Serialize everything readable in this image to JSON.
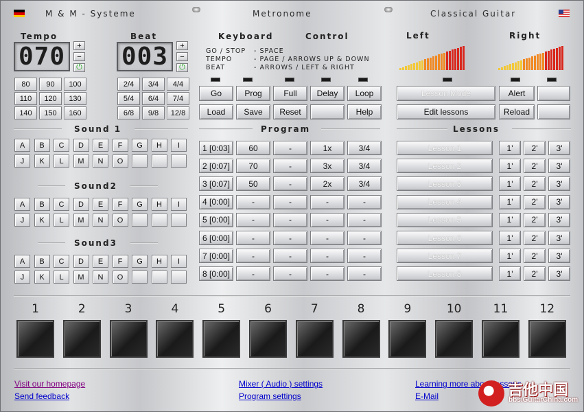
{
  "header": {
    "app_title": "M & M - Systeme",
    "center_title": "Metronome",
    "right_title": "Classical Guitar"
  },
  "tempo": {
    "label": "Tempo",
    "display": "070",
    "plus": "+",
    "minus": "−",
    "buttons": [
      "80",
      "90",
      "100",
      "110",
      "120",
      "130",
      "140",
      "150",
      "160"
    ]
  },
  "beat": {
    "label": "Beat",
    "display": "003",
    "plus": "+",
    "minus": "−",
    "buttons": [
      "2/4",
      "3/4",
      "4/4",
      "5/4",
      "6/4",
      "7/4",
      "6/8",
      "9/8",
      "12/8"
    ]
  },
  "keyboard": {
    "label": "Keyboard",
    "control_label": "Control",
    "lines": [
      {
        "k": "GO / STOP",
        "v": "- SPACE"
      },
      {
        "k": "TEMPO",
        "v": "- PAGE / ARROWS UP & DOWN"
      },
      {
        "k": "BEAT",
        "v": "- ARROWS / LEFT & RIGHT"
      }
    ]
  },
  "meters": {
    "left": "Left",
    "right": "Right"
  },
  "controls": [
    "Go",
    "Prog",
    "Full",
    "Delay",
    "Loop",
    "Load",
    "Save",
    "Reset",
    "",
    "Help"
  ],
  "lesson_controls": {
    "lesson_mode": "Lesson Mode",
    "alert": "Alert",
    "edit": "Edit lessons",
    "reload": "Reload"
  },
  "sound1": {
    "label": "Sound 1",
    "row1": [
      "A",
      "B",
      "C",
      "D",
      "E",
      "F",
      "G",
      "H",
      "I"
    ],
    "row2": [
      "J",
      "K",
      "L",
      "M",
      "N",
      "O",
      "",
      ""
    ]
  },
  "sound2": {
    "label": "Sound2",
    "row1": [
      "A",
      "B",
      "C",
      "D",
      "E",
      "F",
      "G",
      "H",
      "I"
    ],
    "row2": [
      "J",
      "K",
      "L",
      "M",
      "N",
      "O",
      "",
      ""
    ]
  },
  "sound3": {
    "label": "Sound3",
    "row1": [
      "A",
      "B",
      "C",
      "D",
      "E",
      "F",
      "G",
      "H",
      "I"
    ],
    "row2": [
      "J",
      "K",
      "L",
      "M",
      "N",
      "O",
      "",
      ""
    ]
  },
  "program": {
    "label": "Program",
    "rows": [
      [
        "1 [0:03]",
        "60",
        "-",
        "1x",
        "3/4"
      ],
      [
        "2 [0:07]",
        "70",
        "-",
        "3x",
        "3/4"
      ],
      [
        "3 [0:07]",
        "50",
        "-",
        "2x",
        "3/4"
      ],
      [
        "4 [0:00]",
        "-",
        "-",
        "-",
        "-"
      ],
      [
        "5 [0:00]",
        "-",
        "-",
        "-",
        "-"
      ],
      [
        "6 [0:00]",
        "-",
        "-",
        "-",
        "-"
      ],
      [
        "7 [0:00]",
        "-",
        "-",
        "-",
        "-"
      ],
      [
        "8 [0:00]",
        "-",
        "-",
        "-",
        "-"
      ]
    ]
  },
  "lessons": {
    "label": "Lessons",
    "items": [
      "Lesson 1",
      "Lesson 2",
      "Lesson 3",
      "Lesson 4",
      "Lesson 5",
      "Lesson 6",
      "Lesson 7",
      "Lesson 8"
    ],
    "durations": [
      "1'",
      "2'",
      "3'"
    ]
  },
  "pads": [
    "1",
    "2",
    "3",
    "4",
    "5",
    "6",
    "7",
    "8",
    "9",
    "10",
    "11",
    "12"
  ],
  "links": {
    "homepage": "Visit our homepage",
    "feedback": "Send feedback",
    "mixer": "Mixer ( Audio ) settings",
    "program": "Program settings",
    "learn": "Learning more about lessons",
    "email": "E-Mail"
  },
  "watermark": {
    "text": "吉他中国",
    "url": "bbs.GuitarChina.com"
  }
}
